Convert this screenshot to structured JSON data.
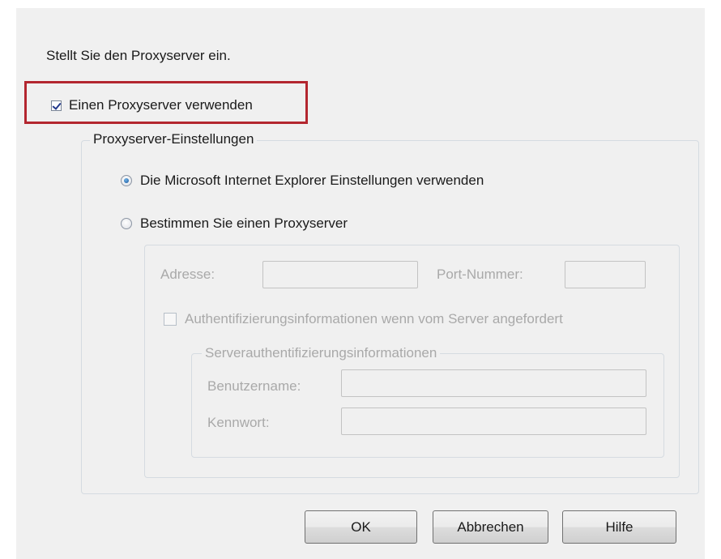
{
  "dialog": {
    "intro_text": "Stellt Sie den Proxyserver ein.",
    "use_proxy": {
      "label": "Einen Proxyserver verwenden",
      "checked": true
    },
    "proxy_settings": {
      "legend": "Proxyserver-Einstellungen",
      "radio_ie": {
        "label": "Die Microsoft Internet Explorer Einstellungen verwenden",
        "selected": true
      },
      "radio_custom": {
        "label": "Bestimmen Sie einen Proxyserver",
        "selected": false
      },
      "address": {
        "label": "Adresse:",
        "value": ""
      },
      "port": {
        "label": "Port-Nummer:",
        "value": ""
      },
      "auth": {
        "label": "Authentifizierungsinformationen wenn vom Server angefordert",
        "checked": false
      },
      "server_auth": {
        "legend": "Serverauthentifizierungsinformationen",
        "username": {
          "label": "Benutzername:",
          "value": ""
        },
        "password": {
          "label": "Kennwort:",
          "value": ""
        }
      }
    },
    "buttons": {
      "ok": "OK",
      "cancel": "Abbrechen",
      "help": "Hilfe"
    },
    "highlight_color": "#b3262f"
  }
}
